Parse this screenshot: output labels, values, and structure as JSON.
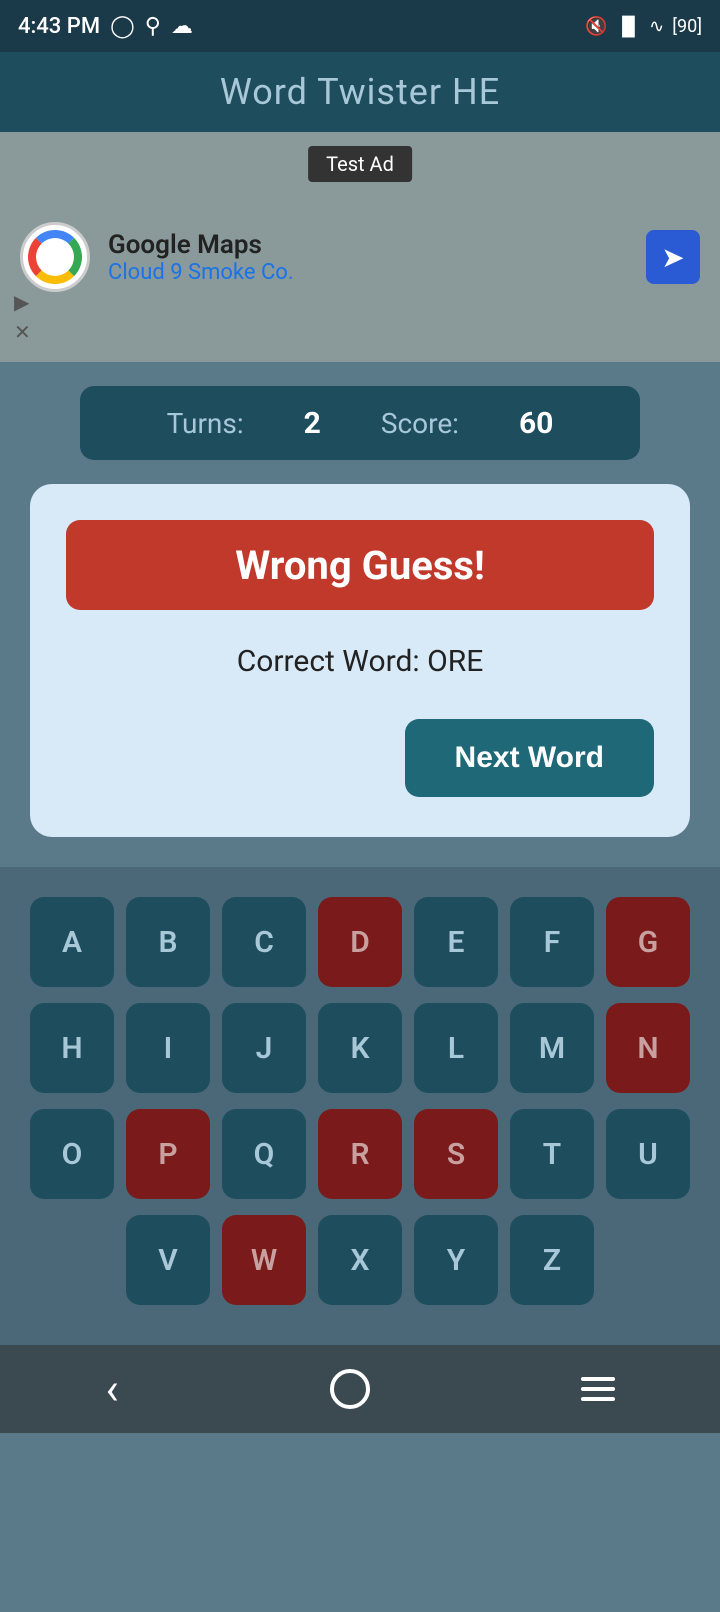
{
  "statusBar": {
    "time": "4:43 PM",
    "battery": "90"
  },
  "header": {
    "title": "Word Twister HE"
  },
  "ad": {
    "label": "Test Ad",
    "company": "Google Maps",
    "subtitle": "Cloud 9 Smoke Co."
  },
  "score": {
    "turnsLabel": "Turns:",
    "turnsValue": "2",
    "scoreLabel": "Score:",
    "scoreValue": "60"
  },
  "resultCard": {
    "wrongGuessText": "Wrong Guess!",
    "correctWordLabel": "Correct Word: ORE",
    "nextWordButton": "Next Word"
  },
  "keyboard": {
    "rows": [
      [
        {
          "letter": "A",
          "used": false
        },
        {
          "letter": "B",
          "used": false
        },
        {
          "letter": "C",
          "used": false
        },
        {
          "letter": "D",
          "used": true
        },
        {
          "letter": "E",
          "used": false
        },
        {
          "letter": "F",
          "used": false
        },
        {
          "letter": "G",
          "used": true
        }
      ],
      [
        {
          "letter": "H",
          "used": false
        },
        {
          "letter": "I",
          "used": false
        },
        {
          "letter": "J",
          "used": false
        },
        {
          "letter": "K",
          "used": false
        },
        {
          "letter": "L",
          "used": false
        },
        {
          "letter": "M",
          "used": false
        },
        {
          "letter": "N",
          "used": true
        }
      ],
      [
        {
          "letter": "O",
          "used": false
        },
        {
          "letter": "P",
          "used": true
        },
        {
          "letter": "Q",
          "used": false
        },
        {
          "letter": "R",
          "used": true
        },
        {
          "letter": "S",
          "used": true
        },
        {
          "letter": "T",
          "used": false
        },
        {
          "letter": "U",
          "used": false
        }
      ],
      [
        {
          "letter": "V",
          "used": false
        },
        {
          "letter": "W",
          "used": true
        },
        {
          "letter": "X",
          "used": false
        },
        {
          "letter": "Y",
          "used": false
        },
        {
          "letter": "Z",
          "used": false
        }
      ]
    ]
  }
}
